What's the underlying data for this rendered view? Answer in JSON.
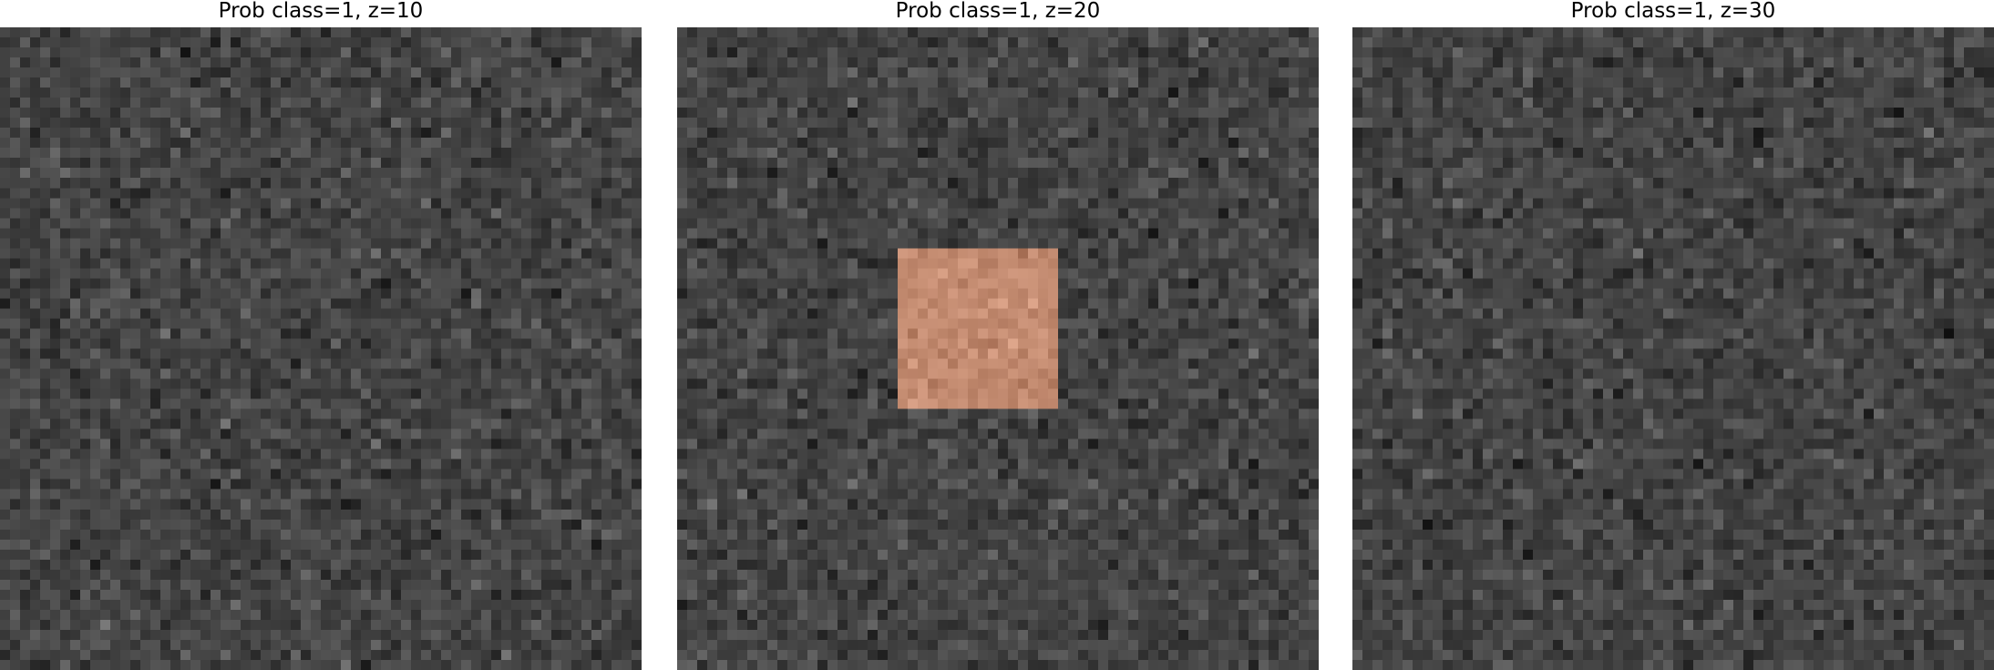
{
  "figure": {
    "panels": [
      {
        "title": "Prob class=1, z=10",
        "z": 10,
        "overlay_visible": false
      },
      {
        "title": "Prob class=1, z=20",
        "z": 20,
        "overlay_visible": true
      },
      {
        "title": "Prob class=1, z=30",
        "z": 30,
        "overlay_visible": false
      }
    ],
    "background_colormap": "gray",
    "overlay_color": "#e8a07e",
    "image_grid_size": 64
  }
}
